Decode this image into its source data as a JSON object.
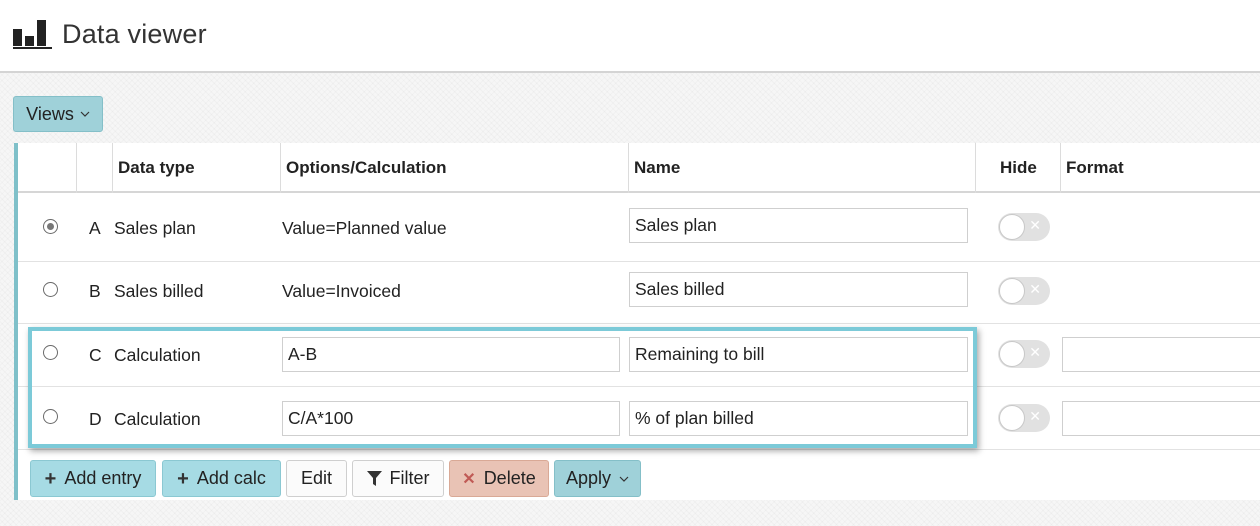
{
  "app": {
    "title": "Data viewer"
  },
  "toolbar": {
    "views_label": "Views"
  },
  "table": {
    "headers": {
      "data_type": "Data type",
      "options": "Options/Calculation",
      "name": "Name",
      "hide": "Hide",
      "format": "Format"
    },
    "rows": [
      {
        "selected": true,
        "letter": "A",
        "data_type": "Sales plan",
        "options": "Value=Planned value",
        "name": "Sales plan"
      },
      {
        "selected": false,
        "letter": "B",
        "data_type": "Sales billed",
        "options": "Value=Invoiced",
        "name": "Sales billed"
      },
      {
        "selected": false,
        "letter": "C",
        "data_type": "Calculation",
        "options": "A-B",
        "name": "Remaining to bill"
      },
      {
        "selected": false,
        "letter": "D",
        "data_type": "Calculation",
        "options": "C/A*100",
        "name": "% of plan billed"
      }
    ]
  },
  "actions": {
    "add_entry": "Add entry",
    "add_calc": "Add calc",
    "edit": "Edit",
    "filter": "Filter",
    "delete": "Delete",
    "apply": "Apply"
  },
  "colors": {
    "accent": "#9fd1d9",
    "highlight": "#7ccad8",
    "delete": "#e9c3b5"
  }
}
